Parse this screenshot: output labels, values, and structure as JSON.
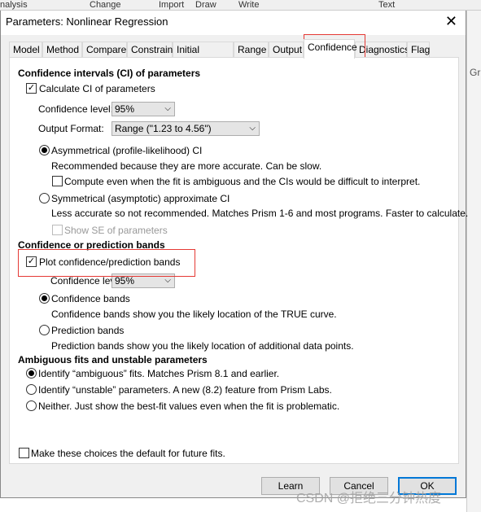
{
  "background": {
    "menu": [
      "nalysis",
      "Change",
      "Import",
      "Draw",
      "Write",
      "Text"
    ],
    "side_text": "Gr"
  },
  "dialog": {
    "title": "Parameters: Nonlinear Regression",
    "tabs": [
      "Model",
      "Method",
      "Compare",
      "Constrain",
      "Initial values",
      "Range",
      "Output",
      "Confidence",
      "Diagnostics",
      "Flag"
    ],
    "active_tab": "Confidence",
    "ci": {
      "heading": "Confidence intervals (CI) of parameters",
      "calc_label": "Calculate CI of parameters",
      "calc_checked": true,
      "level_label": "Confidence level:",
      "level_value": "95%",
      "format_label": "Output Format:",
      "format_value": "Range (\"1.23 to 4.56\")",
      "asym_label": "Asymmetrical (profile-likelihood) CI",
      "asym_desc": "Recommended because they are more accurate. Can be slow.",
      "compute_label": "Compute even when the fit is ambiguous and the CIs would be difficult to interpret.",
      "compute_checked": false,
      "sym_label": "Symmetrical (asymptotic) approximate CI",
      "sym_desc": "Less accurate so not recommended. Matches Prism 1-6 and most programs. Faster to calculate.",
      "se_label": "Show SE of parameters",
      "se_checked": false,
      "selected": "asymmetrical"
    },
    "bands": {
      "heading": "Confidence or prediction bands",
      "plot_label": "Plot confidence/prediction bands",
      "plot_checked": true,
      "level_label": "Confidence level:",
      "level_value": "95%",
      "conf_label": "Confidence bands",
      "conf_desc": "Confidence bands show you the likely location of the TRUE curve.",
      "pred_label": "Prediction bands",
      "pred_desc": "Prediction bands show you the likely location of additional data points.",
      "selected": "confidence"
    },
    "ambiguous": {
      "heading": "Ambiguous fits and unstable parameters",
      "options": [
        "Identify “ambiguous” fits. Matches Prism 8.1 and earlier.",
        "Identify “unstable” parameters. A new (8.2) feature from Prism Labs.",
        "Neither. Just show the best-fit values even when the fit is problematic."
      ],
      "selected": 0
    },
    "default_label": "Make these choices the default for future fits.",
    "default_checked": false,
    "buttons": {
      "learn": "Learn",
      "cancel": "Cancel",
      "ok": "OK"
    }
  },
  "watermark": "CSDN @拒绝三分钟热度",
  "colors": {
    "highlight": "#e53935",
    "default_button": "#0078d7"
  }
}
